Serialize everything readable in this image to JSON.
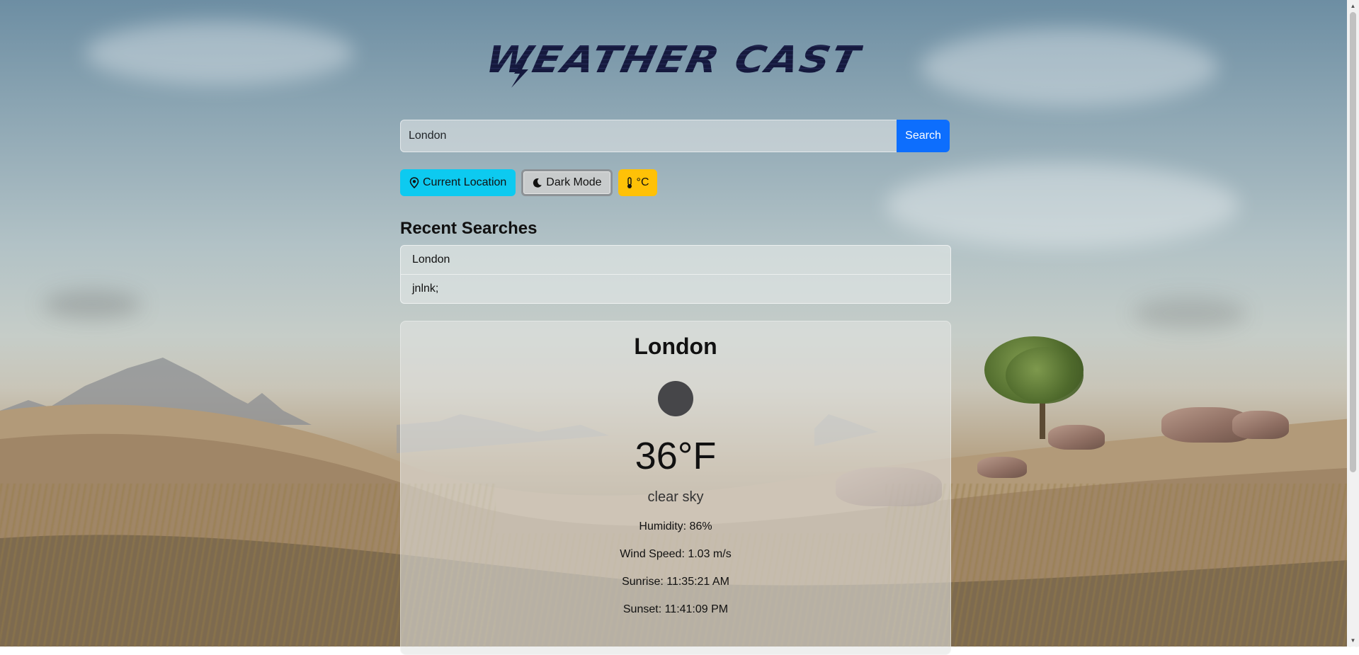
{
  "logo": {
    "text": "WEATHER CAST"
  },
  "search": {
    "value": "London",
    "placeholder": "",
    "button_label": "Search"
  },
  "actions": {
    "location_label": "Current Location",
    "dark_mode_label": "Dark Mode",
    "unit_label": "°C"
  },
  "recent": {
    "title": "Recent Searches",
    "items": [
      {
        "label": "London"
      },
      {
        "label": "jnlnk;"
      }
    ]
  },
  "weather": {
    "city": "London",
    "icon": "weather-icon",
    "temperature": "36°F",
    "description": "clear sky",
    "humidity": "Humidity: 86%",
    "wind": "Wind Speed: 1.03 m/s",
    "sunrise": "Sunrise: 11:35:21 AM",
    "sunset": "Sunset: 11:41:09 PM"
  },
  "colors": {
    "search_button": "#0d6efd",
    "location_button": "#0dcaf0",
    "unit_button": "#ffc107",
    "logo": "#15193d"
  }
}
